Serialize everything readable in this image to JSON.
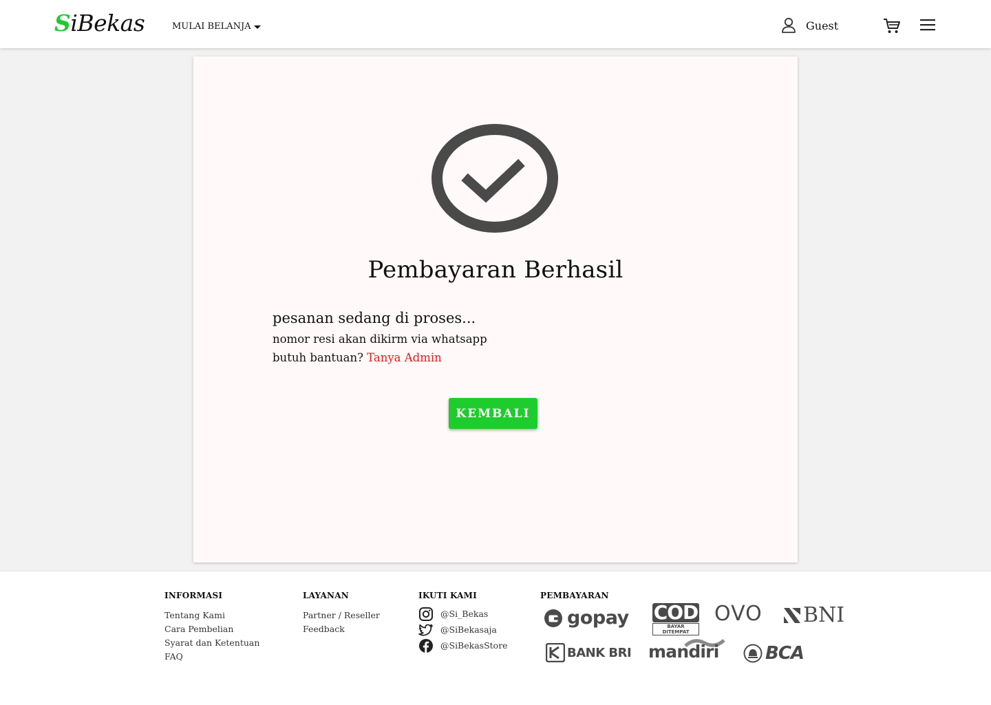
{
  "header": {
    "logo_initial": "S",
    "logo_rest": "iBekas",
    "menu_label": "MULAI BELANJA",
    "user_label": "Guest"
  },
  "card": {
    "title": "Pembayaran Berhasil",
    "message_processing": "pesanan sedang di proses...",
    "message_resi": "nomor resi akan dikirm via whatsapp",
    "help_prefix": "butuh bantuan?",
    "help_link": "Tanya Admin",
    "back_button": "KEMBALI"
  },
  "footer": {
    "informasi": {
      "heading": "INFORMASI",
      "links": [
        "Tentang Kami",
        "Cara Pembelian",
        "Syarat dan Ketentuan",
        "FAQ"
      ]
    },
    "layanan": {
      "heading": "LAYANAN",
      "links": [
        "Partner / Reseller",
        "Feedback"
      ]
    },
    "ikuti": {
      "heading": "IKUTI KAMI",
      "instagram": "@Si_Bekas",
      "twitter": "@SiBekasaja",
      "facebook": "@SiBekasStore"
    },
    "pembayaran": {
      "heading": "PEMBAYARAN",
      "gopay": "gopay",
      "cod": "COD",
      "cod_sub": "BAYAR DITEMPAT",
      "ovo": "OVO",
      "bni": "BNI",
      "bri": "BANK BRI",
      "mandiri": "mandiri",
      "bca": "BCA"
    }
  },
  "colors": {
    "brand_green": "#22c834",
    "button_green": "#1fcc2e",
    "link_red": "#e01b1b",
    "icon_dark": "#4a4a4a"
  }
}
